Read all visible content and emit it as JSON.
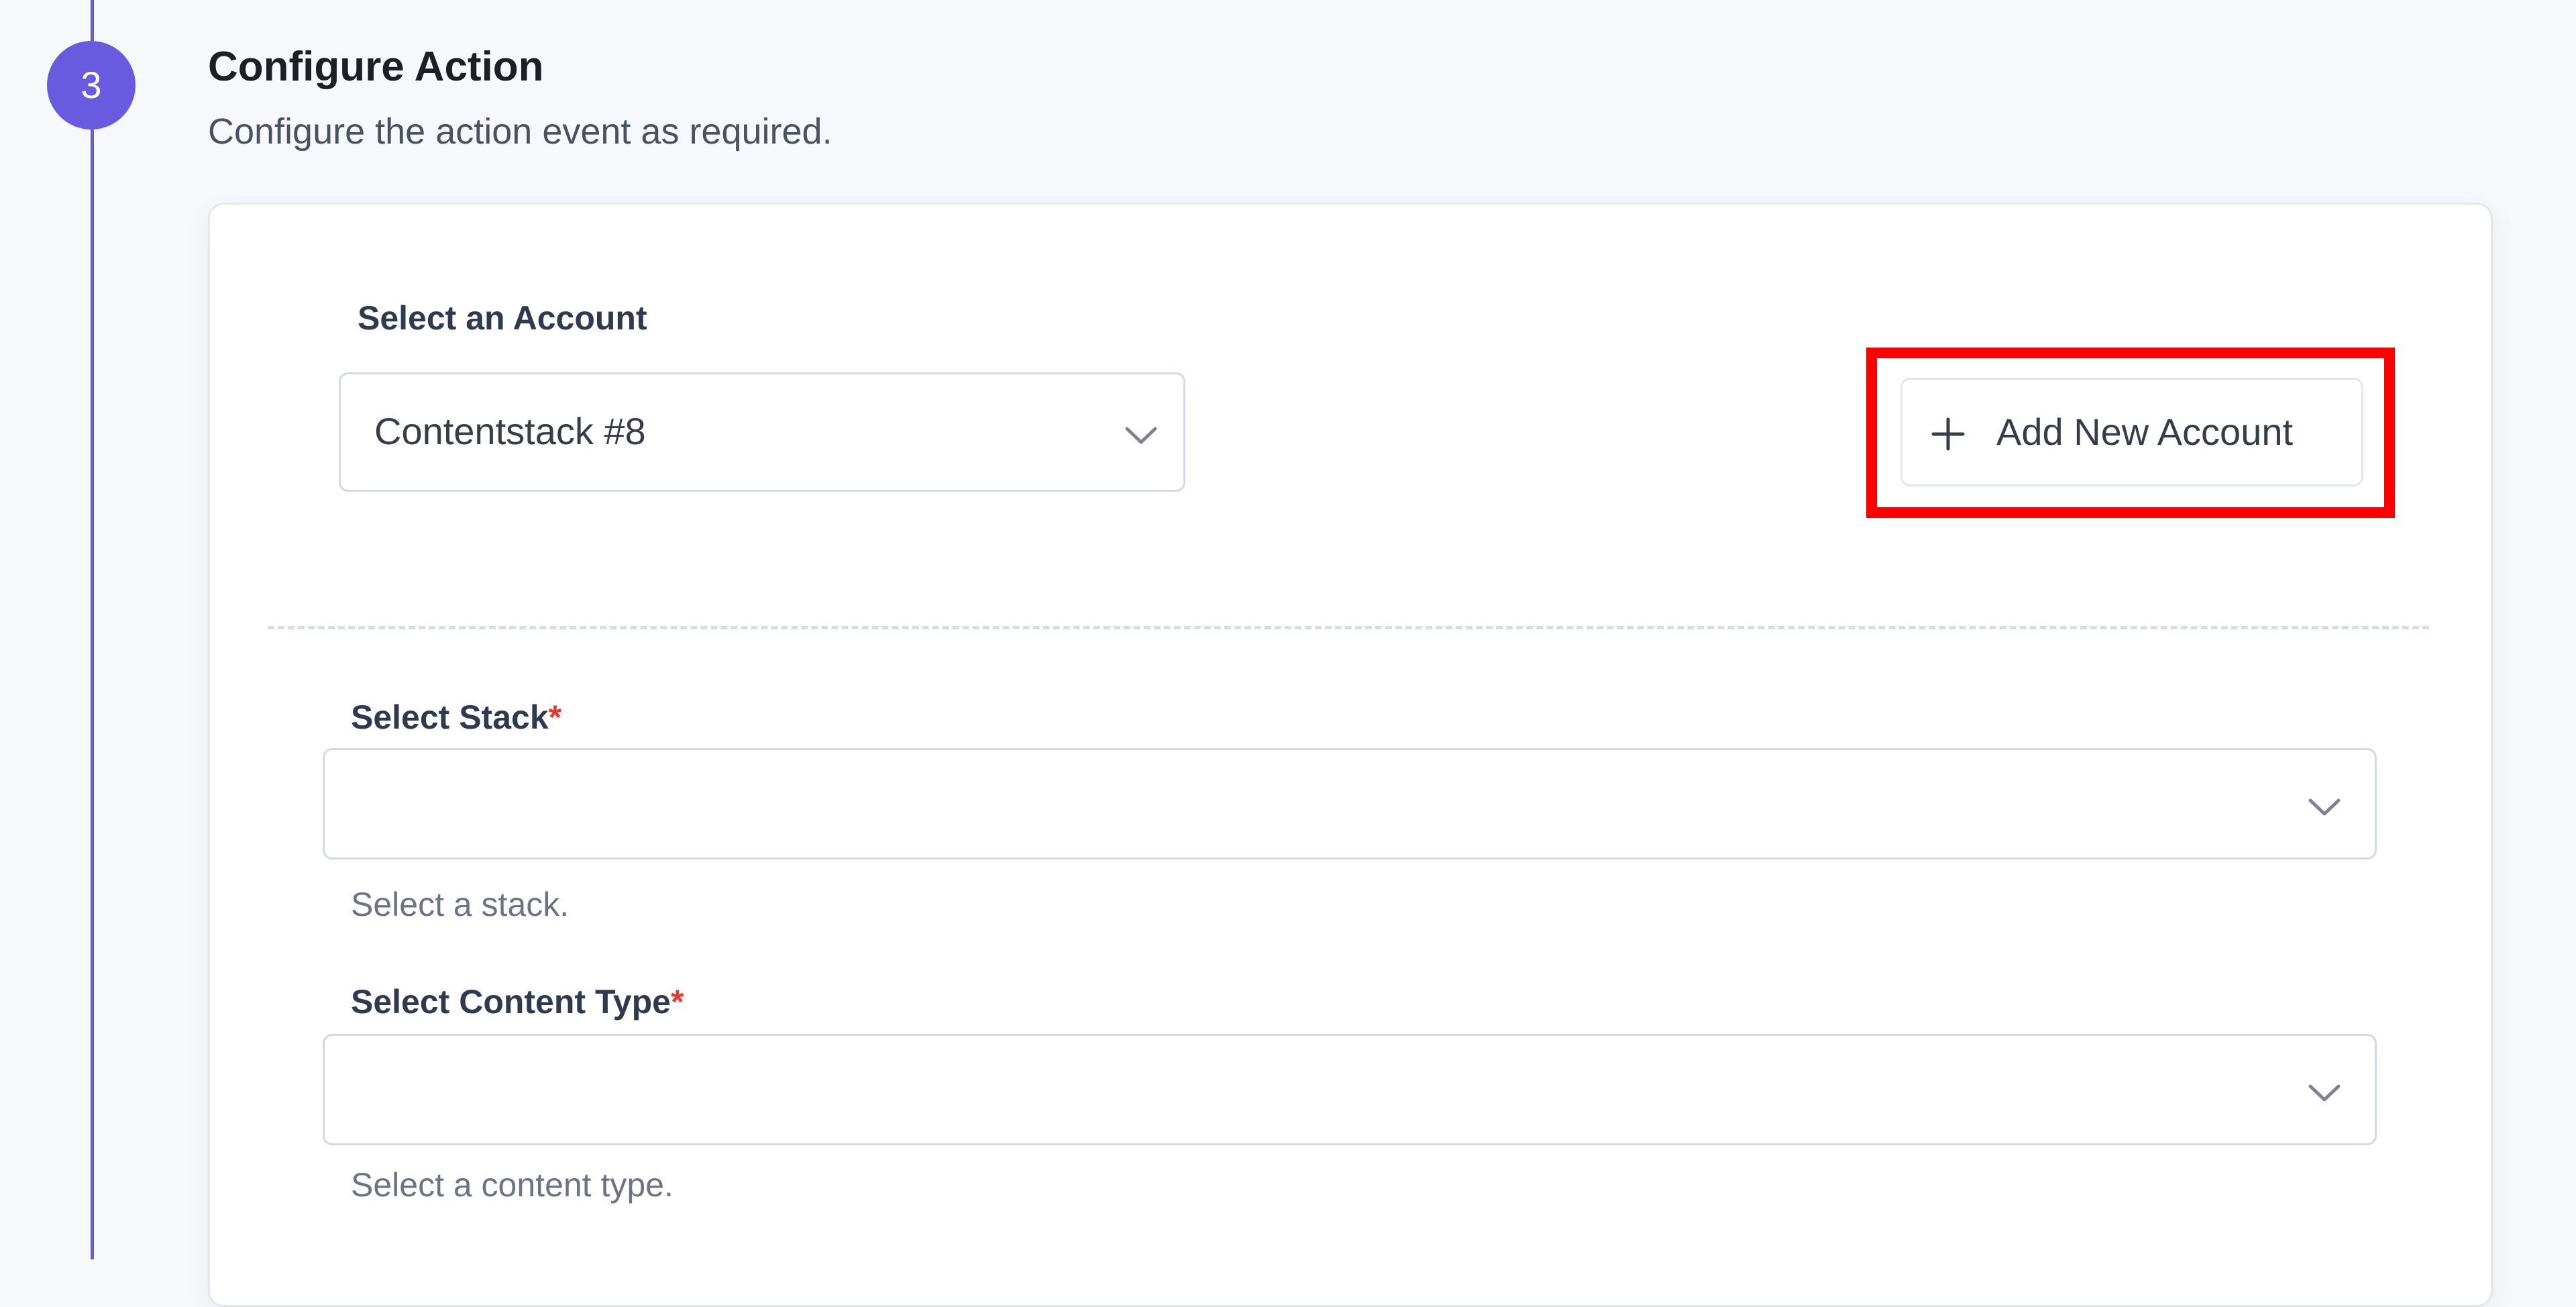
{
  "step": {
    "number": "3",
    "title": "Configure Action",
    "subtitle": "Configure the action event as required."
  },
  "account": {
    "label": "Select an Account",
    "selected": "Contentstack #8",
    "add_button_label": "Add New Account"
  },
  "stack": {
    "label": "Select Stack",
    "required": "*",
    "value": "",
    "helper": "Select a stack."
  },
  "content_type": {
    "label": "Select Content Type",
    "required": "*",
    "value": "",
    "helper": "Select a content type."
  },
  "colors": {
    "accent": "#6a5ae0",
    "highlight": "#ff0000",
    "required": "#e53935"
  },
  "icons": {
    "dropdown": "chevron-down-icon",
    "add": "plus-icon"
  }
}
